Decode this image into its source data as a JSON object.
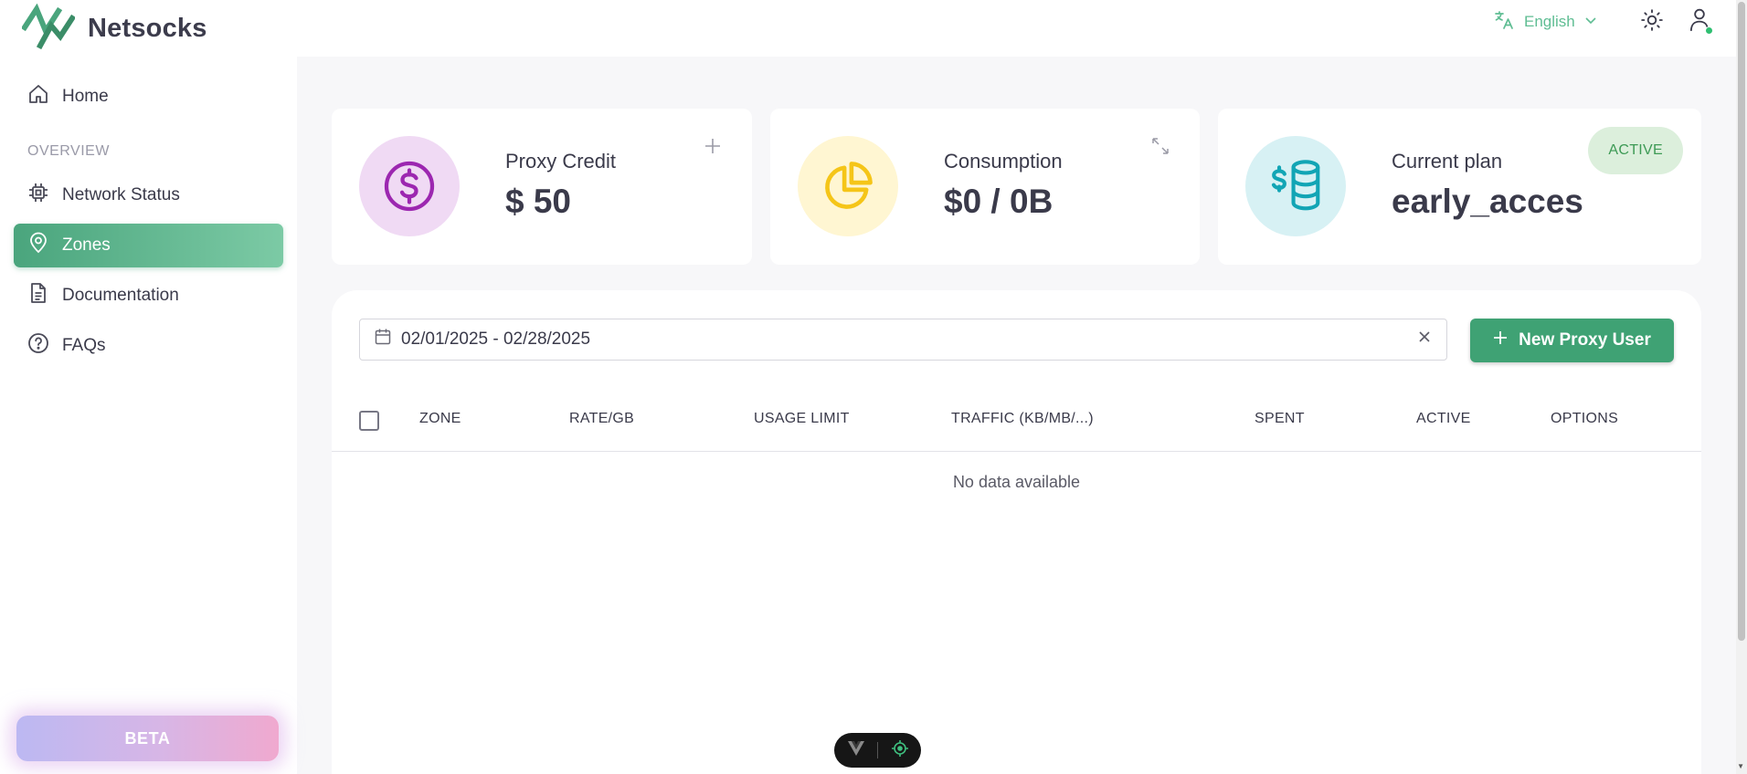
{
  "brand": {
    "name": "Netsocks",
    "logo_icon": "netsocks-logo-icon",
    "accent": "#3fa274"
  },
  "sidebar": {
    "items": [
      {
        "label": "Home",
        "icon": "home-icon"
      },
      {
        "label": "Network Status",
        "icon": "chip-icon"
      },
      {
        "label": "Zones",
        "icon": "location-pin-icon",
        "active": true
      },
      {
        "label": "Documentation",
        "icon": "document-icon"
      },
      {
        "label": "FAQs",
        "icon": "help-circle-icon"
      }
    ],
    "section_label": "OVERVIEW",
    "beta_label": "BETA"
  },
  "topbar": {
    "language": "English",
    "language_icon": "translate-icon",
    "theme_icon": "sun-icon",
    "user_icon": "user-icon"
  },
  "cards": [
    {
      "label": "Proxy Credit",
      "value": "$ 50",
      "icon": "dollar-circle-icon",
      "icon_color": "#9c27b0",
      "bg_color": "#f0daf4",
      "action_icon": "plus-icon"
    },
    {
      "label": "Consumption",
      "value": "$0 / 0B",
      "icon": "pie-chart-icon",
      "icon_color": "#f5c518",
      "bg_color": "#fff6d2",
      "action_icon": "expand-icon"
    },
    {
      "label": "Current plan",
      "value": "early_acces",
      "icon": "coins-stack-icon",
      "icon_color": "#12a5b5",
      "bg_color": "#d7f1f4",
      "badge": "ACTIVE"
    }
  ],
  "zones_panel": {
    "date_range": "02/01/2025 - 02/28/2025",
    "new_button": "New Proxy User",
    "columns": [
      "ZONE",
      "RATE/GB",
      "USAGE LIMIT",
      "TRAFFIC (KB/MB/...)",
      "SPENT",
      "ACTIVE",
      "OPTIONS"
    ],
    "empty_text": "No data available"
  }
}
